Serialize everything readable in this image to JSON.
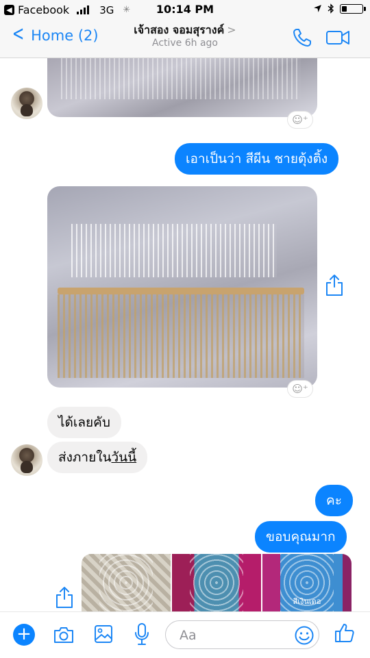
{
  "status_bar": {
    "back_app": "Facebook",
    "network": "3G",
    "time": "10:14 PM",
    "battery_level": 0.25
  },
  "nav": {
    "back_label": "Home (2)",
    "contact_name": "เจ้าสอง จอมสุรางค์",
    "status": "Active 6h ago",
    "icons": [
      "phone-icon",
      "video-camera-icon"
    ]
  },
  "messages": [
    {
      "type": "image",
      "from": "them"
    },
    {
      "type": "text",
      "from": "me",
      "text": "เอาเป็นว่า สีผีน ชายตุ้งติ้ง"
    },
    {
      "type": "image",
      "from": "them"
    },
    {
      "type": "text",
      "from": "them",
      "text": "ได้เลยคับ"
    },
    {
      "type": "text",
      "from": "them",
      "text_plain": "ส่งภายใน",
      "text_underlined": "วันนี้"
    },
    {
      "type": "text",
      "from": "me",
      "text": "คะ"
    },
    {
      "type": "text",
      "from": "me",
      "text": "ขอบคุณมาก"
    },
    {
      "type": "image_group",
      "from": "them",
      "thumbs": 3,
      "caption": "สีเงินเดอ"
    }
  ],
  "composer": {
    "placeholder": "Aa",
    "icons": [
      "plus-icon",
      "camera-icon",
      "image-icon",
      "microphone-icon",
      "emoji-icon",
      "thumbs-up-icon"
    ]
  },
  "colors": {
    "accent": "#0b84ff",
    "nav_link": "#1b86f5",
    "incoming_bubble": "#f1f0f0",
    "status_gray": "#8e8e93"
  }
}
